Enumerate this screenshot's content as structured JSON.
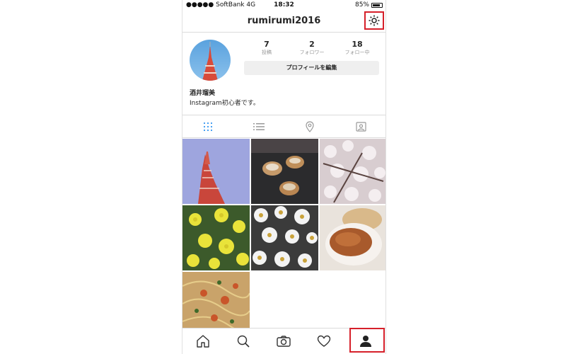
{
  "status_bar": {
    "signal": "●●●●●",
    "carrier": "SoftBank",
    "network": "4G",
    "time": "18:32",
    "battery": "85%",
    "battery_level": 0.85
  },
  "header": {
    "username": "rumirumi2016",
    "settings_icon": "gear-icon"
  },
  "profile": {
    "stats": [
      {
        "count": "7",
        "label": "投稿"
      },
      {
        "count": "2",
        "label": "フォロワー"
      },
      {
        "count": "18",
        "label": "フォロー中"
      }
    ],
    "edit_button": "プロフィールを編集",
    "name": "酒井瑠美",
    "bio": "Instagram初心者です。"
  },
  "view_tabs": [
    {
      "icon": "grid-icon",
      "active": true
    },
    {
      "icon": "list-icon",
      "active": false
    },
    {
      "icon": "location-pin-icon",
      "active": false
    },
    {
      "icon": "tagged-photos-icon",
      "active": false
    }
  ],
  "photos": [
    "tokyo-tower",
    "okonomiyaki",
    "cherry-blossoms",
    "yellow-flowers",
    "daisies",
    "hamburg-steak",
    "pasta"
  ],
  "bottom_nav": [
    {
      "icon": "home-icon"
    },
    {
      "icon": "search-icon"
    },
    {
      "icon": "camera-icon"
    },
    {
      "icon": "heart-icon"
    },
    {
      "icon": "profile-icon",
      "active": true
    }
  ],
  "colors": {
    "accent": "#3897f0",
    "highlight": "#d6202a",
    "border": "#dbdbdb"
  }
}
